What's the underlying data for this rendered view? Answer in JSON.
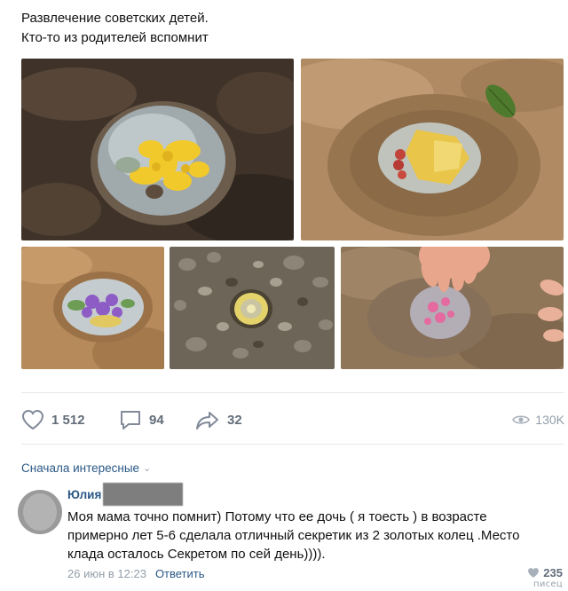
{
  "post": {
    "line1": "Развлечение советских детей.",
    "line2": "Кто-то из родителей вспомнит"
  },
  "actions": {
    "likes": "1 512",
    "comments": "94",
    "shares": "32",
    "views": "130K"
  },
  "comments_sort": {
    "label": "Сначала интересные"
  },
  "comment": {
    "author": "Юлия",
    "text_lines": [
      "Моя мама точно помнит) Потому что ее дочь ( я тоесть ) в возрасте",
      "примерно лет 5-6 сделала отличный секретик из 2 золотых колец .Место",
      "клада осталось Секретом по сей день))))."
    ],
    "date": "26 июн в 12:23",
    "reply_label": "Ответить",
    "likes": "235"
  },
  "watermark": "писец",
  "icons": {
    "like": "heart-icon",
    "comment": "comment-bubble-icon",
    "share": "share-arrow-icon",
    "views": "eye-icon",
    "sort": "chevron-down-icon"
  },
  "colors": {
    "link": "#2a5885",
    "muted": "#939ea9",
    "action": "#626d7a",
    "divider": "#e7e8ec"
  }
}
